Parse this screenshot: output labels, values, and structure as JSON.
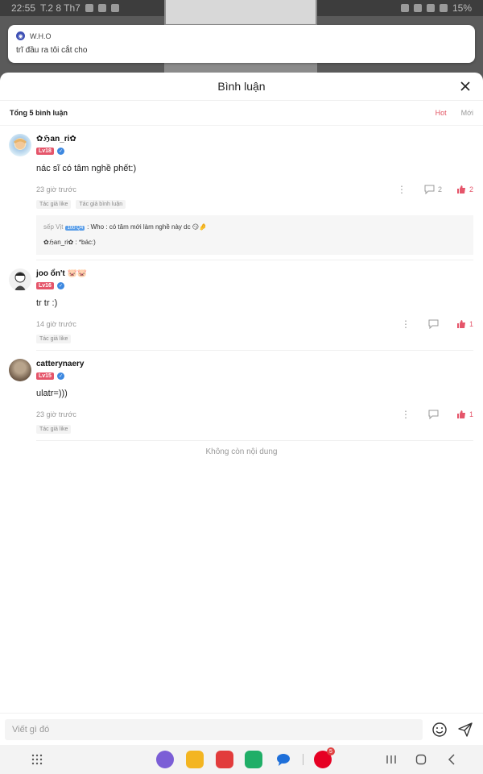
{
  "status_bar": {
    "time": "22:55",
    "date": "T.2 8 Th7",
    "battery": "15%"
  },
  "notification": {
    "app_name": "W.H.O",
    "message": "trĩ đầu ra tôi cắt cho"
  },
  "sheet": {
    "title": "Bình luận"
  },
  "summary": {
    "count_label": "Tổng 5 bình luận",
    "tabs": [
      {
        "label": "Hot",
        "active": true
      },
      {
        "label": "Mới",
        "active": false
      }
    ]
  },
  "comments": [
    {
      "username": "✿ℌan_ri✿",
      "level": "Lv18",
      "text": "nác sĩ có tâm nghề phết:)",
      "time": "23 giờ trước",
      "reply_count": "2",
      "like_count": "2",
      "tags": [
        "Tác giả like",
        "Tác giả bình luận"
      ],
      "replies": [
        {
          "name": "sếp Vịt",
          "badge": "100 Q4",
          "text": ": Who : có tâm mới làm nghề này dc 😏🤌"
        },
        {
          "name": "✿ℌan_ri✿",
          "badge": "",
          "text": ": *bác:)"
        }
      ]
    },
    {
      "username": "joo ổn't 🐷🐷",
      "level": "Lv16",
      "text": "tr tr :)",
      "time": "14 giờ trước",
      "reply_count": "",
      "like_count": "1",
      "tags": [
        "Tác giả like"
      ],
      "replies": []
    },
    {
      "username": "catterynaery",
      "level": "Lv15",
      "text": "ulatr=)))",
      "time": "23 giờ trước",
      "reply_count": "",
      "like_count": "1",
      "tags": [
        "Tác giả like"
      ],
      "replies": []
    }
  ],
  "no_more_text": "Không còn nội dung",
  "input": {
    "placeholder": "Viết gì đó"
  },
  "nav": {
    "pinterest_badge": "5"
  },
  "colors": {
    "accent": "#e25563",
    "like": "#e5556a",
    "verify": "#3d88e0"
  }
}
